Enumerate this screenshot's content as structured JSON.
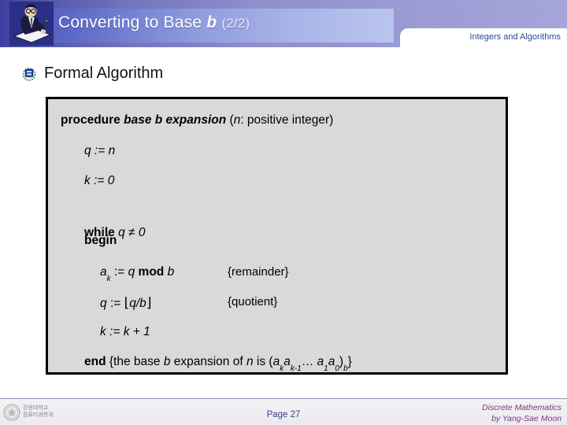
{
  "header": {
    "title_main": "Converting to Base",
    "title_italic_var": "b",
    "title_count": "(2/2)",
    "section_chip": "Integers and Algorithms",
    "writer_icon": "person-writing-icon",
    "banner_color": "#8f9bdd",
    "band_color": "#6f74bd"
  },
  "slide": {
    "heading": "Formal Algorithm",
    "bullet_icon": "blue-square-globe-bullet-icon"
  },
  "algorithm": {
    "box_fill": "#d9d9d9",
    "box_border": "#000000",
    "lines": {
      "procedure_kw": "procedure",
      "procedure_name": "base b expansion",
      "procedure_params_open": "(",
      "procedure_param_var": "n",
      "procedure_param_rest": ": positive integer)",
      "q_init": "q := n",
      "k_init": "k := 0",
      "while_kw": "while",
      "while_cond": "q ≠ 0",
      "begin_kw": "begin",
      "ak_assign_var": "a",
      "ak_assign_sub": "k",
      "ak_assign_rest_1": ":= ",
      "ak_assign_q": "q",
      "ak_assign_mod": "mod",
      "ak_assign_b": "b",
      "ak_comment": "{remainder}",
      "q_update_lhs": "q",
      "q_update_op": ":= ",
      "q_update_floor_open": "⌊",
      "q_update_expr": "q/b",
      "q_update_floor_close": "⌋",
      "q_comment": "{quotient}",
      "k_update": "k := k + 1",
      "end_kw": "end",
      "end_comment_1": "{the base ",
      "end_comment_b": "b",
      "end_comment_2": " expansion of ",
      "end_comment_n": "n",
      "end_comment_3": " is (",
      "end_a1": "a",
      "end_a1_sub": "k",
      "end_a2": "a",
      "end_a2_sub": "k-1",
      "end_ellipsis": "… ",
      "end_a3": "a",
      "end_a3_sub": "1",
      "end_a4": "a",
      "end_a4_sub": "0",
      "end_close": ")",
      "end_base_sub": "b",
      "end_brace": "}"
    }
  },
  "footer": {
    "logo_icon": "university-seal-icon",
    "logo_text_line1": "강원대학교",
    "logo_text_line2": "컴퓨터과학과",
    "page_number": "Page 27",
    "course_line1": "Discrete Mathematics",
    "course_line2": "by Yang-Sae Moon",
    "course_color": "#7a3a72",
    "page_color": "#3b3f82"
  }
}
